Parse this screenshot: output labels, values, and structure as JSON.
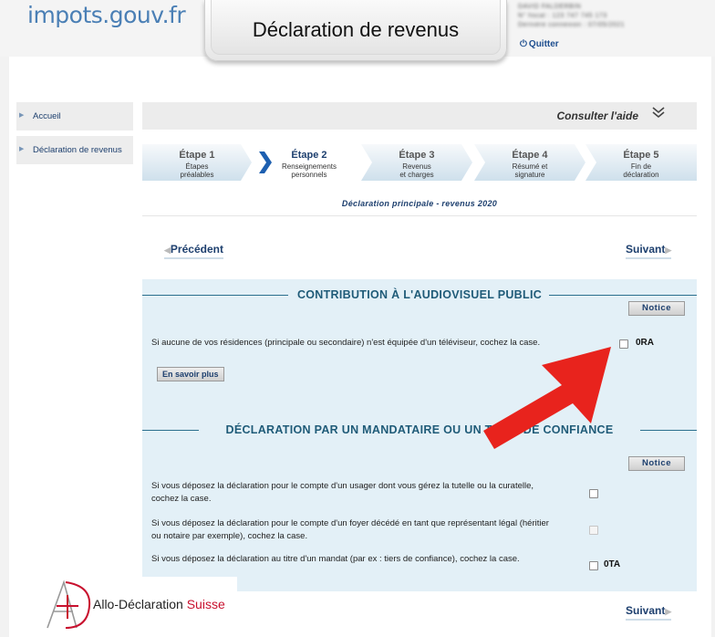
{
  "header": {
    "logo": "impots.gouv.fr",
    "title": "Déclaration de revenus",
    "user_lines": [
      "DAVID FALDERBIN",
      "N° fiscal : 123 747 745 173",
      "Dernière connexion : 07/05/2021"
    ],
    "quitter_label": "Quitter"
  },
  "sidebar": {
    "items": [
      {
        "label": "Accueil"
      },
      {
        "label": "Déclaration de revenus"
      }
    ]
  },
  "help": {
    "label": "Consulter l'aide"
  },
  "steps": [
    {
      "title": "Étape 1",
      "line1": "Étapes",
      "line2": "préalables",
      "state": "done"
    },
    {
      "title": "Étape 2",
      "line1": "Renseignements",
      "line2": "personnels",
      "state": "active"
    },
    {
      "title": "Étape 3",
      "line1": "Revenus",
      "line2": "et charges",
      "state": "todo"
    },
    {
      "title": "Étape 4",
      "line1": "Résumé et",
      "line2": "signature",
      "state": "todo"
    },
    {
      "title": "Étape 5",
      "line1": "Fin de",
      "line2": "déclaration",
      "state": "todo"
    }
  ],
  "declaration_label": "Déclaration principale - revenus 2020",
  "nav": {
    "previous": "Précédent",
    "next": "Suivant"
  },
  "section_audiovisuel": {
    "title": "CONTRIBUTION À L'AUDIOVISUEL PUBLIC",
    "notice": "Notice",
    "question": "Si aucune de vos résidences (principale ou secondaire) n'est équipée d'un téléviseur, cochez la case.",
    "code": "0RA",
    "savoir_plus": "En savoir plus"
  },
  "section_mandataire": {
    "title": "DÉCLARATION PAR UN MANDATAIRE OU UN TIERS DE CONFIANCE",
    "notice": "Notice",
    "questions": [
      {
        "text": "Si vous déposez la déclaration pour le compte d'un usager dont vous gérez la tutelle ou la curatelle, cochez la case.",
        "code": "",
        "enabled": true
      },
      {
        "text": "Si vous déposez la déclaration pour le compte d'un foyer décédé en tant que représentant légal (héritier ou notaire par exemple), cochez la case.",
        "code": "",
        "enabled": false
      },
      {
        "text": "Si vous déposez la déclaration au titre d'un mandat (par ex : tiers de confiance), cochez la case.",
        "code": "0TA",
        "enabled": true
      }
    ]
  },
  "watermark": {
    "text_main": "Allo-Déclaration",
    "text_accent": "Suisse"
  },
  "colors": {
    "accent": "#1f5b78",
    "link": "#1d3f6e",
    "section_bg": "#e3f0f7",
    "arrow": "#e8231d"
  }
}
